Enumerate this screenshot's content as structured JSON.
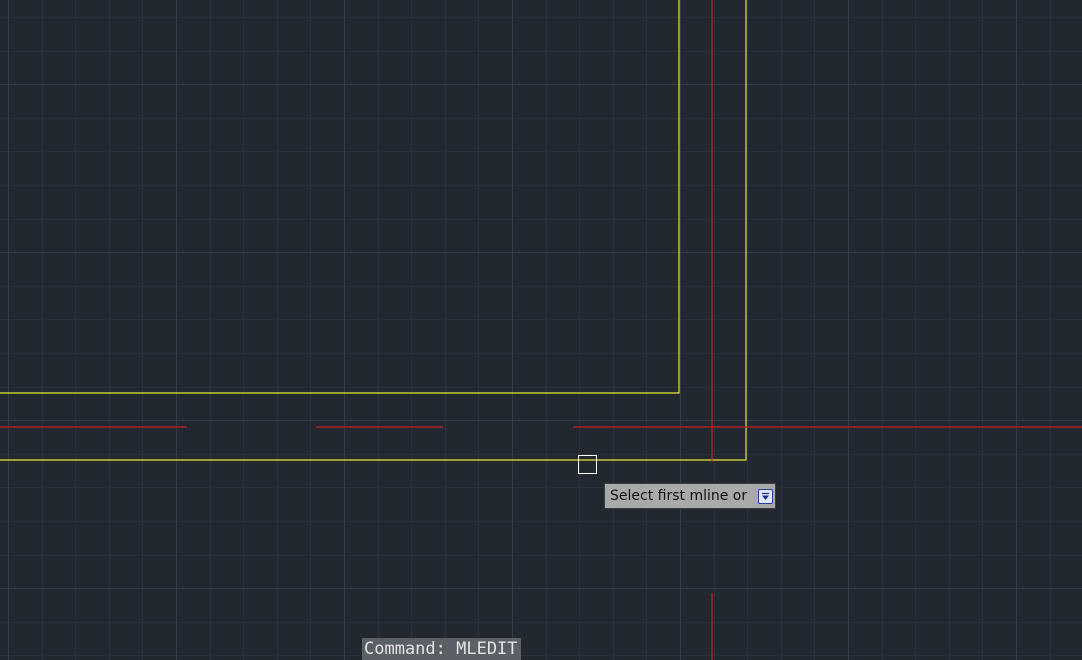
{
  "tooltip": {
    "prompt": "Select first mline or",
    "options_icon": "down-arrow-icon"
  },
  "command_line": {
    "text": "Command: MLEDIT"
  },
  "colors": {
    "background": "#212830",
    "grid_minor": "#2a313b",
    "grid_major": "#343c47",
    "mline": "#e6e632",
    "centerline": "#c81e1e",
    "pickbox": "#ffffff",
    "tooltip_bg": "#a9a9a9"
  }
}
